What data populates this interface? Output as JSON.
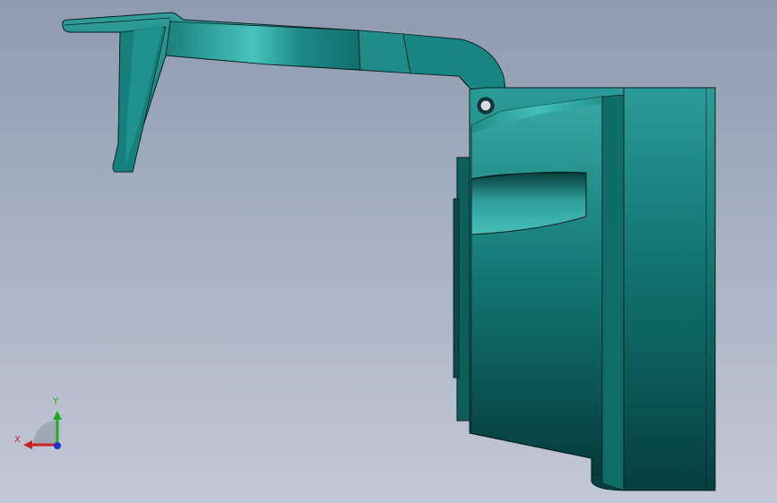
{
  "viewport": {
    "background_top": "#8e9bb0",
    "background_bottom": "#c2c9d6"
  },
  "model": {
    "part_color": "#0e6f6c",
    "highlight_color": "#3fb8b0",
    "edge_color": "#0a1e1e"
  },
  "triad": {
    "x_label": "X",
    "y_label": "Y",
    "x_color": "#cc2222",
    "y_color": "#22aa22",
    "z_color": "#2233cc"
  }
}
